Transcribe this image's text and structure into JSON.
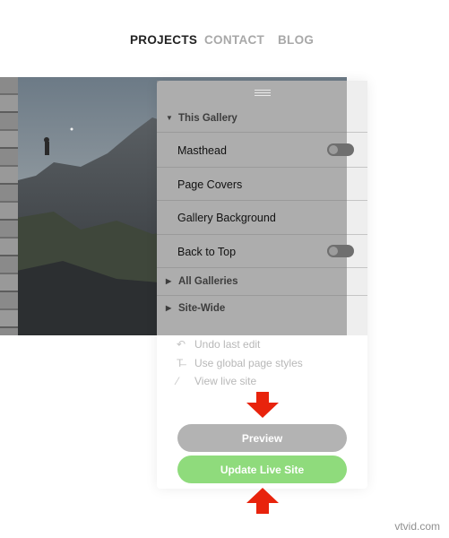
{
  "nav": {
    "items": [
      {
        "label": "PROJECTS"
      },
      {
        "label": "CONTACT"
      },
      {
        "label": "BLOG"
      }
    ]
  },
  "panel": {
    "this_gallery": "This Gallery",
    "rows": [
      {
        "label": "Masthead",
        "toggle": "off"
      },
      {
        "label": "Page Covers"
      },
      {
        "label": "Gallery Background"
      },
      {
        "label": "Back to Top",
        "toggle": "off"
      }
    ],
    "all_galleries": "All Galleries",
    "site_wide": "Site-Wide",
    "actions": [
      {
        "label": "Undo last edit",
        "icon": "undo-icon"
      },
      {
        "label": "Use global page styles",
        "icon": "text-style-icon"
      },
      {
        "label": "View live site",
        "icon": "link-icon"
      }
    ],
    "preview_label": "Preview",
    "update_label": "Update Live Site"
  },
  "colors": {
    "update_button": "#8fdb7c",
    "preview_button": "#b3b3b3",
    "arrow": "#e8230c"
  },
  "watermark": "vtvid.com"
}
